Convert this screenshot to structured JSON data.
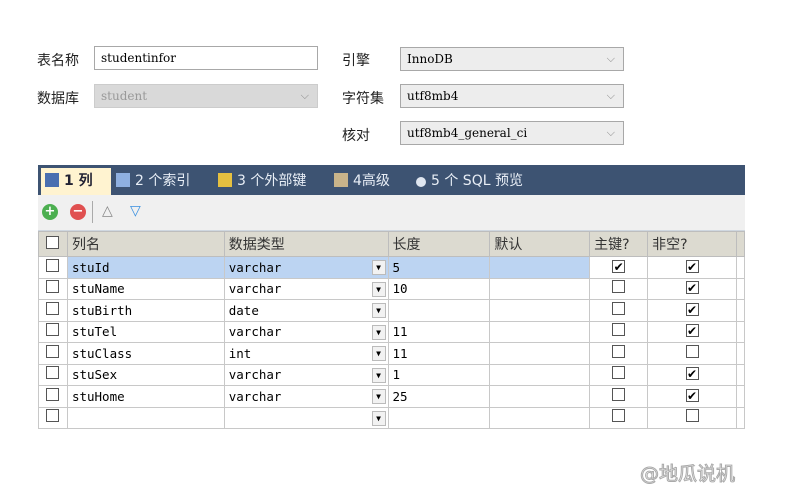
{
  "form": {
    "table_name_label": "表名称",
    "table_name_value": "studentinfor",
    "database_label": "数据库",
    "database_value": "student",
    "engine_label": "引擎",
    "engine_value": "InnoDB",
    "charset_label": "字符集",
    "charset_value": "utf8mb4",
    "collation_label": "核对",
    "collation_value": "utf8mb4_general_ci"
  },
  "tabs": [
    {
      "label": "1 列"
    },
    {
      "label": "2 个索引"
    },
    {
      "label": "3 个外部键"
    },
    {
      "label": "4高级"
    },
    {
      "label": "5 个 SQL 预览"
    }
  ],
  "columns": [
    "列名",
    "数据类型",
    "长度",
    "默认",
    "主键?",
    "非空?"
  ],
  "rows": [
    {
      "name": "stuId",
      "type": "varchar",
      "length": "5",
      "default": "",
      "pk": true,
      "notnull": true
    },
    {
      "name": "stuName",
      "type": "varchar",
      "length": "10",
      "default": "",
      "pk": false,
      "notnull": true
    },
    {
      "name": "stuBirth",
      "type": "date",
      "length": "",
      "default": "",
      "pk": false,
      "notnull": true
    },
    {
      "name": "stuTel",
      "type": "varchar",
      "length": "11",
      "default": "",
      "pk": false,
      "notnull": true
    },
    {
      "name": "stuClass",
      "type": "int",
      "length": "11",
      "default": "",
      "pk": false,
      "notnull": false
    },
    {
      "name": "stuSex",
      "type": "varchar",
      "length": "1",
      "default": "",
      "pk": false,
      "notnull": true
    },
    {
      "name": "stuHome",
      "type": "varchar",
      "length": "25",
      "default": "",
      "pk": false,
      "notnull": true
    },
    {
      "name": "",
      "type": "",
      "length": "",
      "default": "",
      "pk": false,
      "notnull": false
    }
  ],
  "watermark": "@地瓜说机"
}
